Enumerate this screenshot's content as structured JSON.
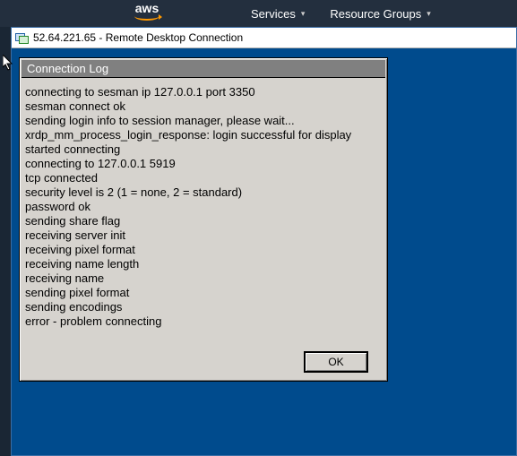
{
  "aws": {
    "logo_text": "aws",
    "menu": [
      {
        "label": "Services"
      },
      {
        "label": "Resource Groups"
      }
    ]
  },
  "window": {
    "title": "52.64.221.65 - Remote Desktop Connection"
  },
  "dialog": {
    "title": "Connection Log",
    "lines": [
      "connecting to sesman ip 127.0.0.1 port 3350",
      "sesman connect ok",
      "sending login info to session manager, please wait...",
      "xrdp_mm_process_login_response: login successful for display",
      "started connecting",
      "connecting to 127.0.0.1 5919",
      "tcp connected",
      "security level is 2 (1 = none, 2 = standard)",
      "password ok",
      "sending share flag",
      "receiving server init",
      "receiving pixel format",
      "receiving name length",
      "receiving name",
      "sending pixel format",
      "sending encodings",
      "error - problem connecting"
    ],
    "ok_label": "OK"
  }
}
